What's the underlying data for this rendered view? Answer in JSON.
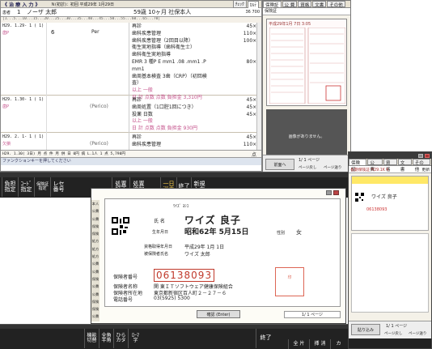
{
  "main": {
    "title": "《 治 療 入 力 》",
    "visit_info": "Ｎ(初診)：初回 平成29年 1月29日",
    "patient": {
      "label": "患者",
      "code": "1",
      "name": "ノーザ 太郎",
      "age": "59歳 10ヶ月 社保本人",
      "right": "36 700"
    },
    "tabs": [
      "ﾁｪｯｸ",
      "ｶﾙﾃ"
    ],
    "ruler": "|1...5...10...15...20...25...30...35...40...45...50...55...60...65...70|",
    "rows": [
      {
        "date": "H29. 1.29- 1 ( 1)",
        "tooth": "6",
        "code": "Per",
        "lines": [
          "再診",
          "歯科疾患管理",
          "歯科疾患管理（2回目以降）",
          "衛生実地指導（歯科衛生士）",
          "歯科衛生実地指導",
          "EMR 3 種P E  mm1  .08  .mm1  .P  mm1",
          "",
          "歯周基本検査 3歯（CRP）（初回検査）",
          "以上 一般",
          "日 計  点数  点数  負担金 3,310円"
        ],
        "points": [
          "45×1",
          "110×1",
          "100×1",
          "",
          "",
          "80×1",
          "",
          "",
          "",
          ""
        ]
      },
      {
        "date": "H29. 1.30- 1 ( 1)",
        "tooth": "",
        "code": "(Perico)",
        "lines": [
          "再診",
          "歯周処置（1口腔1回につき）",
          "投薬 日数",
          "以上 一般",
          "日 計  点数  点数  負担金 930円"
        ],
        "points": [
          "45×1",
          "45×1",
          "45×1",
          "",
          ""
        ]
      },
      {
        "date": "H29. 2. 1- 1 ( 1)",
        "tooth": "",
        "code": "(Perico)",
        "lines": [
          "再診",
          "歯科疾患管理"
        ],
        "points": [
          "45×1",
          "110×1"
        ]
      }
    ],
    "footer": "H29. 1.30( 3日)  月  点  件  月  併  日  0円  病  L.1人 1  点  5,790円",
    "footer_right": "点",
    "status": "ファンクションキーを押してください"
  },
  "right_panel": {
    "tabs": [
      "保険証",
      "公 費",
      "資格",
      "文書",
      "その他"
    ],
    "subtitle": "保険証",
    "card_date": "平成29年1月 7日 3:05",
    "empty_msg": "画像がありません。",
    "page": "1/ 1 ページ",
    "buttons": [
      "ページ戻し",
      "ページ送り"
    ],
    "bottom_label": "前面へ"
  },
  "right_win2": {
    "tabs": [
      "保険証",
      "公 費",
      "資格",
      "文書",
      "その他"
    ],
    "subtitle": "長期保険証 H29.1K K",
    "right_label": "更新",
    "card_name": "ワイズ 良子",
    "card_number": "06138093",
    "page": "1/ 1 ページ",
    "buttons": [
      "ページ戻し",
      "ページ送り"
    ],
    "bottom_label": "貼り込み"
  },
  "dialog": {
    "furigana": "ﾜｲｽﾞ  ﾖｼｺ",
    "name_label": "氏 名",
    "name": "ワイズ 良子",
    "birth_label": "生年月日",
    "birth": "昭和62年 5月15日",
    "sex_label": "性別",
    "sex": "女",
    "qual_label": "資格取得年月日",
    "qual": "平成29年 1月 1日",
    "holder_label": "被保険者氏名",
    "holder": "ワイズ 太郎",
    "insurer_no_label": "保険者番号",
    "insurer_no": "06138093",
    "insurer_name_label": "保険者名称",
    "insurer_name": "関 東ＩＴソフトウェア健康保険組合",
    "insurer_addr_label": "保険者所在地",
    "insurer_addr": "東京都新宿区百人町２－２７－６",
    "phone_label": "電話番号",
    "phone": "03(5925) 5300",
    "confirm": "確認 (Enter)",
    "page": "1/ 1 ページ",
    "side_labels": [
      "本人",
      "公費",
      "公費",
      "保険",
      "保険",
      "処方",
      "処方",
      "処方",
      "公費",
      "公費",
      "保険",
      "公費",
      "公費",
      "保険",
      "保険",
      "公費"
    ]
  },
  "fkeys_top": {
    "labels": [
      "F1",
      "F2",
      "F3",
      "F4",
      "F5",
      "F6",
      "F7",
      "F8",
      "F9",
      "F10",
      "F11",
      "F12"
    ],
    "buttons": [
      "負担\n指定",
      "ｺｰﾄﾞ\n指定",
      "保険証\n指定",
      "レセ\n番号",
      "",
      "処置\n訂正",
      "処置\n追加",
      "一日\n消去",
      "終了",
      "新規\n入力",
      "",
      ""
    ]
  },
  "fkeys_bottom": {
    "buttons": [
      "機能\n切替",
      "全角\n半角",
      "ひら\nカタ",
      "ﾛｰﾏ\n字",
      "",
      "",
      "",
      "",
      "終了",
      "",
      "全 片",
      "挿 消",
      "カ"
    ]
  }
}
